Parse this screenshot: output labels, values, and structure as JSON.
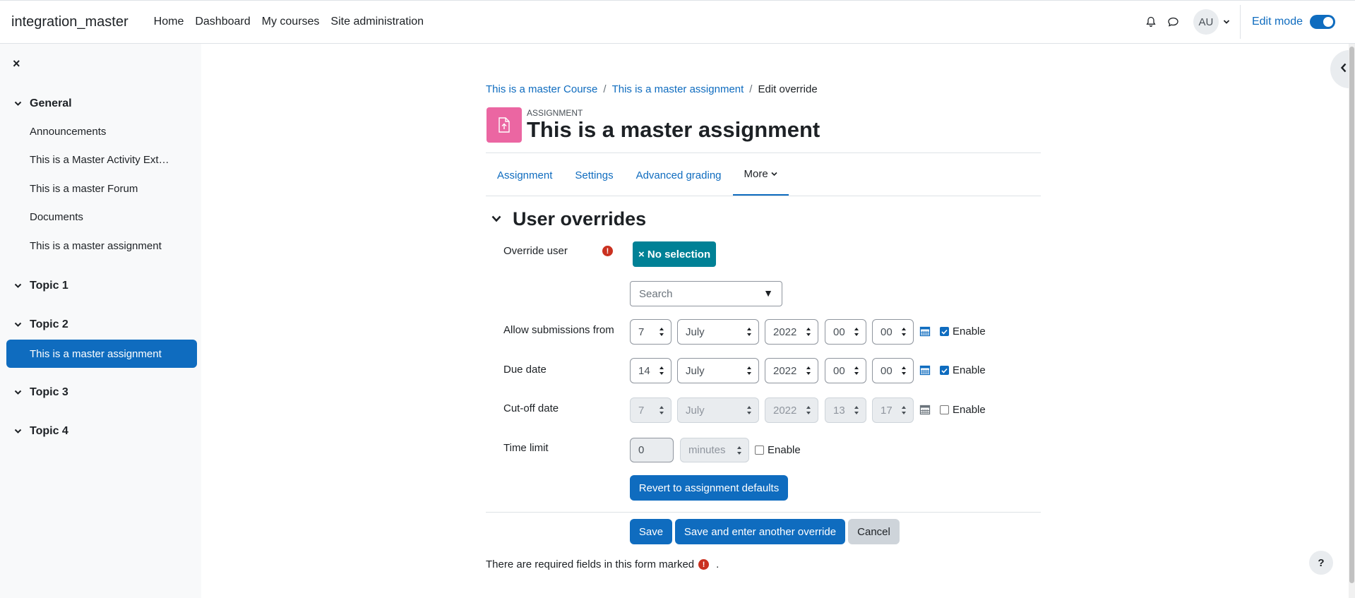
{
  "navbar": {
    "site_name": "integration_master",
    "links": [
      "Home",
      "Dashboard",
      "My courses",
      "Site administration"
    ],
    "user_initials": "AU",
    "edit_mode_label": "Edit mode",
    "icons": [
      "bell-icon",
      "chat-icon",
      "chevron-down-icon"
    ]
  },
  "drawer": {
    "close_icon": "×",
    "sections": [
      {
        "name": "General",
        "items": [
          "Announcements",
          "This is a Master Activity Ext…",
          "This is a master Forum",
          "Documents",
          "This is a master assignment"
        ]
      },
      {
        "name": "Topic 1",
        "items": []
      },
      {
        "name": "Topic 2",
        "items": [
          "This is a master assignment"
        ]
      },
      {
        "name": "Topic 3",
        "items": []
      },
      {
        "name": "Topic 4",
        "items": []
      }
    ]
  },
  "breadcrumb": [
    "This is a master Course",
    "This is a master assignment",
    "Edit override"
  ],
  "activity": {
    "type_label": "ASSIGNMENT",
    "title": "This is a master assignment"
  },
  "tabs": [
    "Assignment",
    "Settings",
    "Advanced grading",
    "More"
  ],
  "section_title": "User overrides",
  "form": {
    "override_user_label": "Override user",
    "no_selection_badge": "× No selection",
    "search_placeholder": "Search",
    "search_arrow": "▼",
    "allow_from": {
      "label": "Allow submissions from",
      "day": "7",
      "month": "July",
      "year": "2022",
      "hour": "00",
      "minute": "00",
      "enabled": true
    },
    "due_date": {
      "label": "Due date",
      "day": "14",
      "month": "July",
      "year": "2022",
      "hour": "00",
      "minute": "00",
      "enabled": true
    },
    "cutoff_date": {
      "label": "Cut-off date",
      "day": "7",
      "month": "July",
      "year": "2022",
      "hour": "13",
      "minute": "17",
      "enabled": false
    },
    "time_limit": {
      "label": "Time limit",
      "value": "0",
      "unit": "minutes",
      "enabled": false
    },
    "enable_label": "Enable",
    "revert_button": "Revert to assignment defaults",
    "save_button": "Save",
    "save_another_button": "Save and enter another override",
    "cancel_button": "Cancel"
  },
  "footnote": {
    "text": "There are required fields in this form marked",
    "end": "."
  },
  "help_label": "?",
  "colors": {
    "primary": "#0f6cbf",
    "badge": "#008196",
    "activity_icon": "#eb66a2",
    "required": "#ca3120"
  }
}
